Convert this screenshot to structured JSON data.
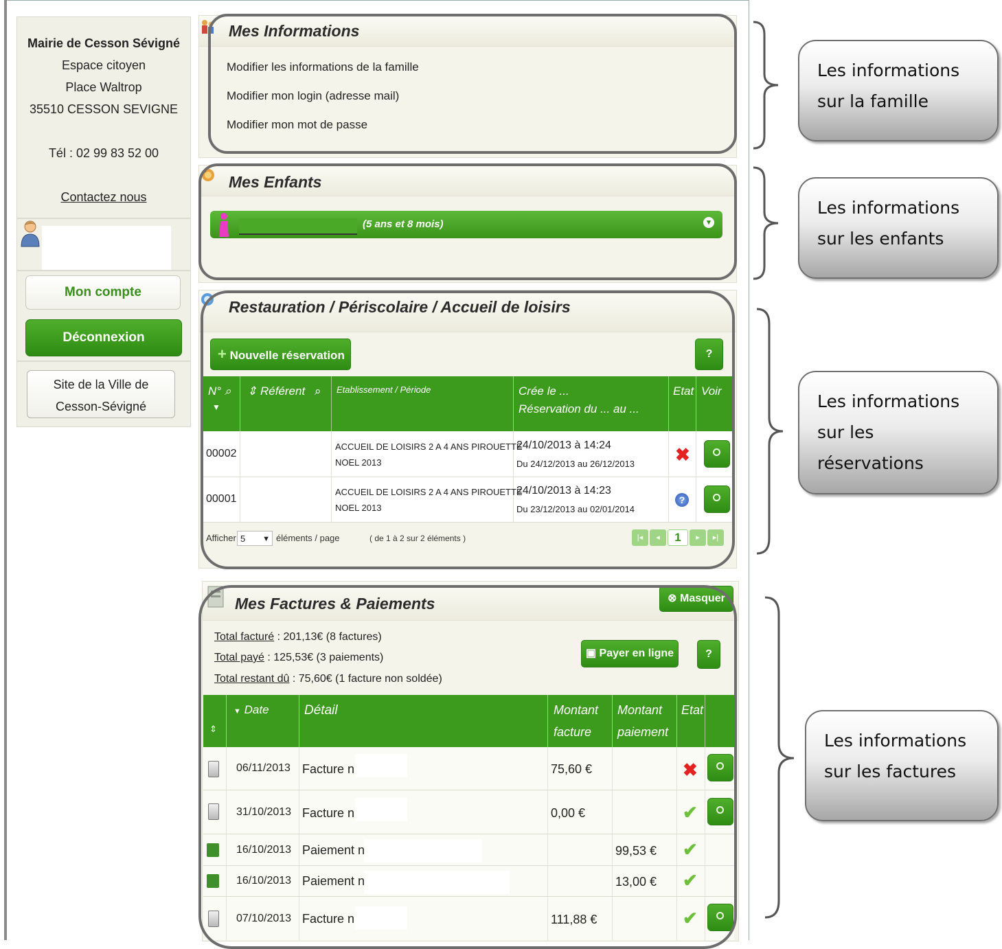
{
  "sidebar": {
    "org": "Mairie de Cesson Sévigné",
    "addr1": "Espace citoyen",
    "addr2": "Place Waltrop",
    "addr3": "35510 CESSON SEVIGNE",
    "phone": "Tél : 02 99 83 52 00",
    "contact": "Contactez nous",
    "account_button": "Mon compte",
    "logout_button": "Déconnexion",
    "site_line1": "Site de la Ville de",
    "site_line2": "Cesson-Sévigné"
  },
  "infos": {
    "title": "Mes Informations",
    "links": [
      "Modifier les informations de la famille",
      "Modifier mon login (adresse mail)",
      "Modifier mon mot de passe"
    ]
  },
  "enfants": {
    "title": "Mes Enfants",
    "age": "(5 ans et 8 mois)"
  },
  "reservations": {
    "title": "Restauration / Périscolaire / Accueil de loisirs",
    "new_button": "Nouvelle réservation",
    "help": "?",
    "headers": {
      "num": "N°",
      "referent": "Référent",
      "etab": "Etablissement / Période",
      "cree1": "Crée le ...",
      "cree2": "Réservation du ... au ...",
      "etat": "Etat",
      "voir": "Voir"
    },
    "rows": [
      {
        "num": "00002",
        "etab1": "ACCUEIL DE LOISIRS 2 A 4 ANS PIROUETTE",
        "etab2": "NOEL 2013",
        "date": "24/10/2013 à 14:24",
        "period": "Du 24/12/2013 au 26/12/2013",
        "etat": "refused"
      },
      {
        "num": "00001",
        "etab1": "ACCUEIL DE LOISIRS 2 A 4 ANS PIROUETTE",
        "etab2": "NOEL 2013",
        "date": "24/10/2013 à 14:23",
        "period": "Du 23/12/2013 au 02/01/2014",
        "etat": "pending"
      }
    ],
    "pager": {
      "show_label": "Afficher",
      "per_page": "5",
      "per_page_label": "éléments / page",
      "range": "( de 1 à 2 sur 2 éléments )",
      "page": "1"
    }
  },
  "factures": {
    "title": "Mes Factures & Paiements",
    "hide_button": "Masquer",
    "pay_button": "Payer en ligne",
    "help": "?",
    "total_facture_label": "Total facturé",
    "total_facture": " : 201,13€ (8 factures)",
    "total_paye_label": "Total payé",
    "total_paye": " : 125,53€ (3 paiements)",
    "total_restant_label": "Total restant dû",
    "total_restant": " : 75,60€ (1 facture non soldée)",
    "headers": {
      "date": "Date",
      "detail": "Détail",
      "montant_facture1": "Montant",
      "montant_facture2": "facture",
      "montant_paiement1": "Montant",
      "montant_paiement2": "paiement",
      "etat": "Etat"
    },
    "rows": [
      {
        "type": "bill",
        "date": "06/11/2013",
        "detail": "Facture n°",
        "facture": "75,60 €",
        "paiement": "",
        "etat": "unpaid"
      },
      {
        "type": "bill",
        "date": "31/10/2013",
        "detail": "Facture n°",
        "facture": "0,00 €",
        "paiement": "",
        "etat": "ok"
      },
      {
        "type": "payment",
        "date": "16/10/2013",
        "detail": "Paiement n°",
        "facture": "",
        "paiement": "99,53 €",
        "etat": "ok"
      },
      {
        "type": "payment",
        "date": "16/10/2013",
        "detail": "Paiement n°",
        "facture": "",
        "paiement": "13,00 €",
        "etat": "ok"
      },
      {
        "type": "bill",
        "date": "07/10/2013",
        "detail": "Facture n°",
        "facture": "111,88 €",
        "paiement": "",
        "etat": "ok"
      }
    ]
  },
  "callouts": {
    "famille": [
      "Les informations",
      "sur la famille"
    ],
    "enfants": [
      "Les informations",
      "sur les enfants"
    ],
    "reservations": [
      "Les informations",
      "sur les",
      "réservations"
    ],
    "factures": [
      "Les informations",
      "sur les factures"
    ]
  },
  "colors": {
    "accent_green": "#3c9b1d",
    "panel_bg": "#f5f4ea",
    "outline_grey": "#6d6d6d"
  }
}
